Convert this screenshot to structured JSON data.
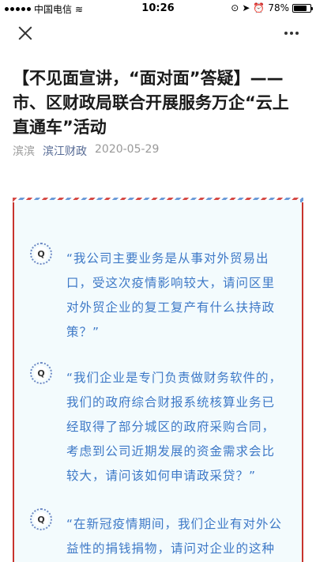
{
  "status_bar": {
    "carrier": "中国电信",
    "time": "10:26",
    "battery": "78%",
    "battery_level": 0.78
  },
  "nav": {
    "close_icon": "close-icon",
    "more_icon": "more-icon"
  },
  "article": {
    "title": "【不见面宣讲，“面对面”答疑】——市、区财政局联合开展服务万企“云上直通车”活动",
    "author": "滨滨",
    "account": "滨江财政",
    "date": "2020-05-29"
  },
  "questions": [
    {
      "icon": "Q",
      "text": "“我公司主要业务是从事对外贸易出口，受这次疫情影响较大，请问区里对外贸企业的复工复产有什么扶持政策？”"
    },
    {
      "icon": "Q",
      "text": "“我们企业是专门负责做财务软件的，我们的政府综合财报系统核算业务已经取得了部分城区的政府采购合同，考虑到公司近期发展的资金需求会比较大，请问该如何申请政采贷？”"
    },
    {
      "icon": "Q",
      "text": "“在新冠疫情期间，我们企业有对外公益性的捐钱捐物，请问对企业的这种捐"
    }
  ],
  "colors": {
    "accent_blue": "#3e79c7",
    "frame_red": "#c8342e",
    "link": "#576b95"
  }
}
